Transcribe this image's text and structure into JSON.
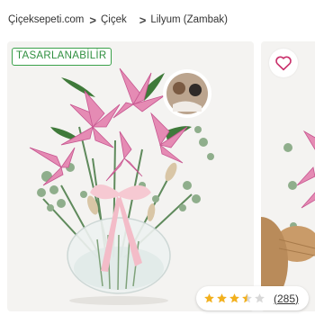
{
  "breadcrumb": {
    "items": [
      {
        "label": "Çiçeksepeti.com"
      },
      {
        "label": "Çiçek"
      },
      {
        "label": "Lilyum (Zambak)"
      }
    ],
    "separator": ">"
  },
  "product": {
    "badge": "TASARLANABİLİR",
    "image_icon": "pink-lily-arrangement-in-glass-vase-with-couple-photo",
    "rating": {
      "stars": 3.5,
      "max": 5,
      "count_label": "(285)",
      "star_color": "#f2b01e",
      "empty_star_color": "#d8d8d8"
    }
  },
  "next_card": {
    "favorite_icon": "heart-outline-icon",
    "heart_color": "#c9306b"
  },
  "colors": {
    "badge_green": "#3aa14a",
    "card_bg": "#f4f3f1"
  }
}
